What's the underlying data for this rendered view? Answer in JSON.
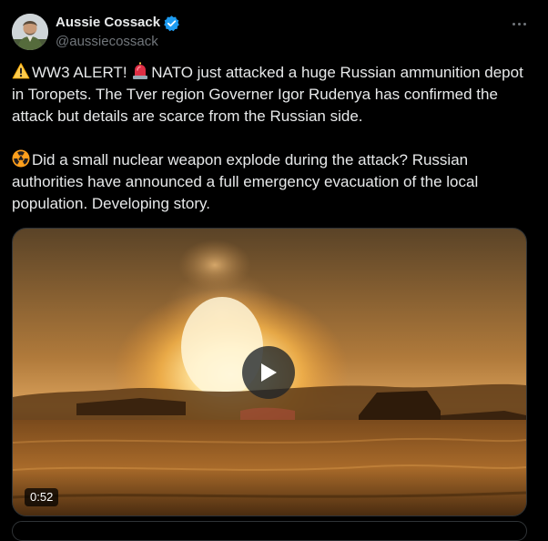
{
  "author": {
    "display_name": "Aussie Cossack",
    "handle": "@aussiecossack",
    "avatar_icon": "user-avatar",
    "verified_icon": "verified-badge-icon",
    "verified_color": "#1d9bf0"
  },
  "more_icon": "more-options-icon",
  "tweet": {
    "paragraph_1": {
      "emoji_1": "warning-icon",
      "text_1": "WW3 ALERT! ",
      "emoji_2": "siren-icon",
      "text_2": "NATO just attacked a huge Russian ammunition depot in Toropets. The Tver region Governer Igor Rudenya has confirmed the attack but details are scarce from the Russian side."
    },
    "paragraph_2": {
      "emoji_1": "radioactive-icon",
      "text_1": "Did a small nuclear weapon explode during the attack? Russian authorities have announced a full emergency evacuation of the local population. Developing story."
    }
  },
  "video": {
    "duration": "0:52",
    "play_icon": "play-icon"
  },
  "colors": {
    "background": "#000000",
    "text_primary": "#e7e9ea",
    "text_secondary": "#71767b",
    "border": "#2f3336"
  }
}
